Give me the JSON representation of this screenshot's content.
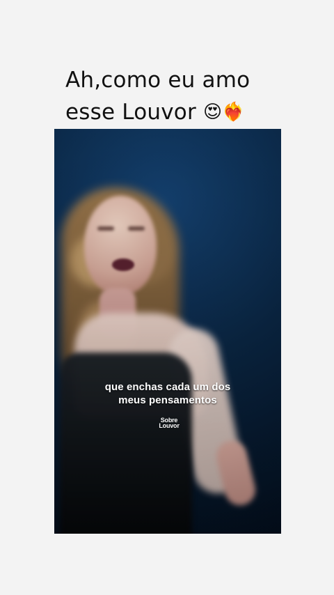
{
  "post": {
    "caption": {
      "line1": "Ah,como eu amo",
      "line2_text": "esse Louvor",
      "emoji_1": "😍",
      "emoji_2": "❤️‍🔥"
    }
  },
  "video": {
    "subtitle": {
      "line1": "que enchas cada um dos",
      "line2": "meus pensamentos"
    },
    "watermark": {
      "line1": "Sobre",
      "line2": "Louvor"
    }
  },
  "colors": {
    "page_background": "#f3f3f3",
    "caption_text": "#111111",
    "video_background": "#0b2a47",
    "subtitle_text": "#ffffff"
  }
}
